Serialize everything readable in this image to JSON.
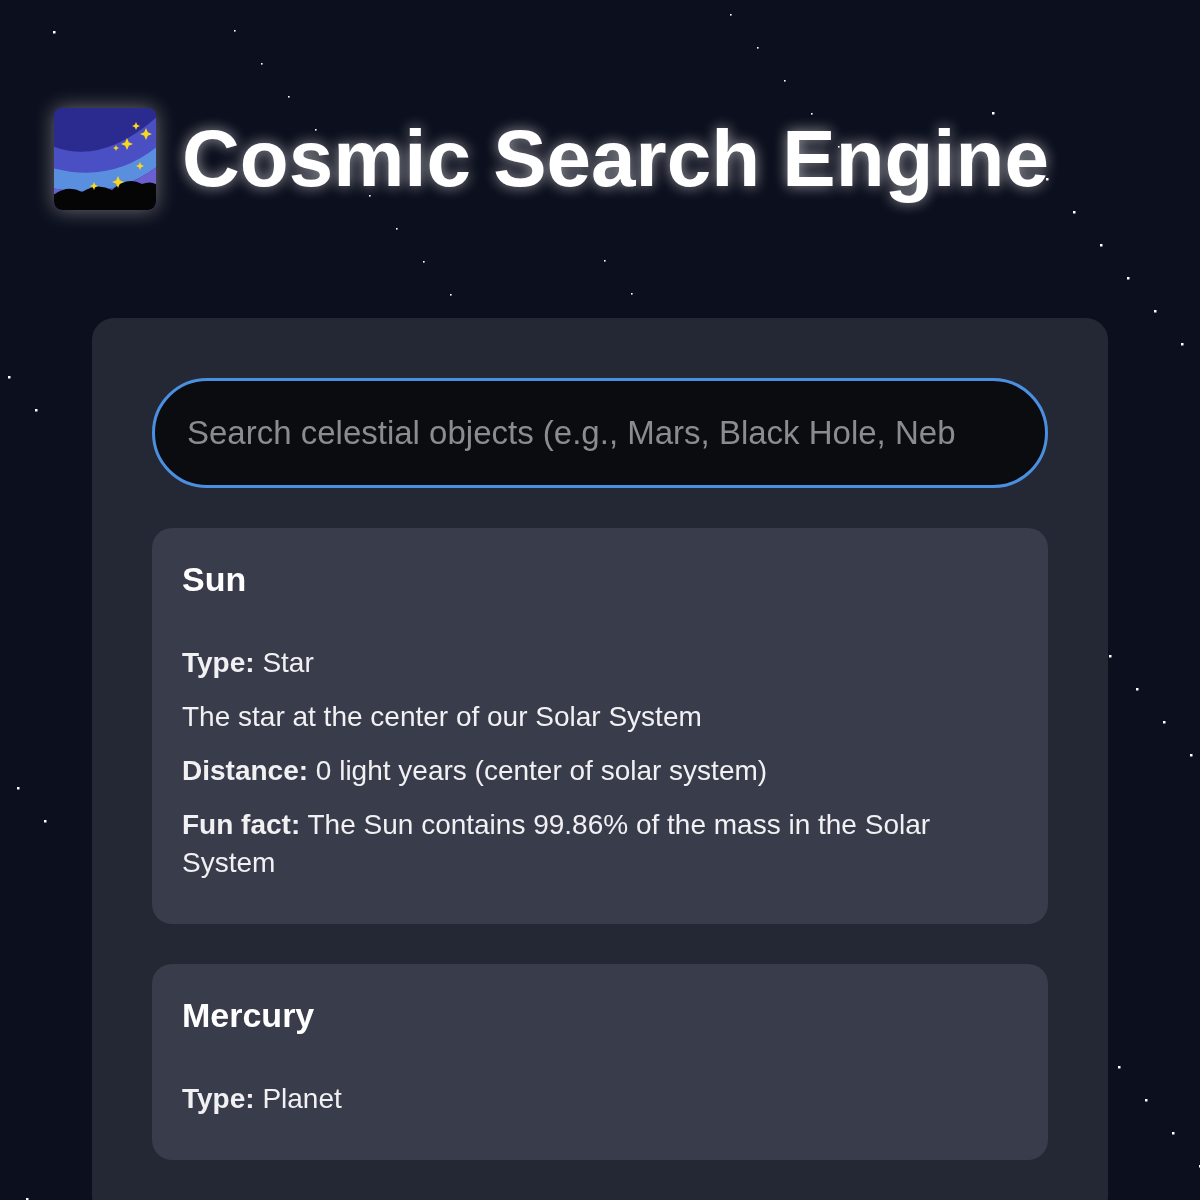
{
  "header": {
    "title": "Cosmic Search Engine"
  },
  "search": {
    "placeholder": "Search celestial objects (e.g., Mars, Black Hole, Neb"
  },
  "results": [
    {
      "name": "Sun",
      "facts": [
        {
          "label": "Type:",
          "value": "Star"
        },
        {
          "value": "The star at the center of our Solar System"
        },
        {
          "label": "Distance:",
          "value": "0 light years (center of solar system)"
        },
        {
          "label": "Fun fact:",
          "value": "The Sun contains 99.86% of the mass in the Solar System"
        }
      ]
    },
    {
      "name": "Mercury",
      "facts": [
        {
          "label": "Type:",
          "value": "Planet"
        }
      ]
    }
  ]
}
